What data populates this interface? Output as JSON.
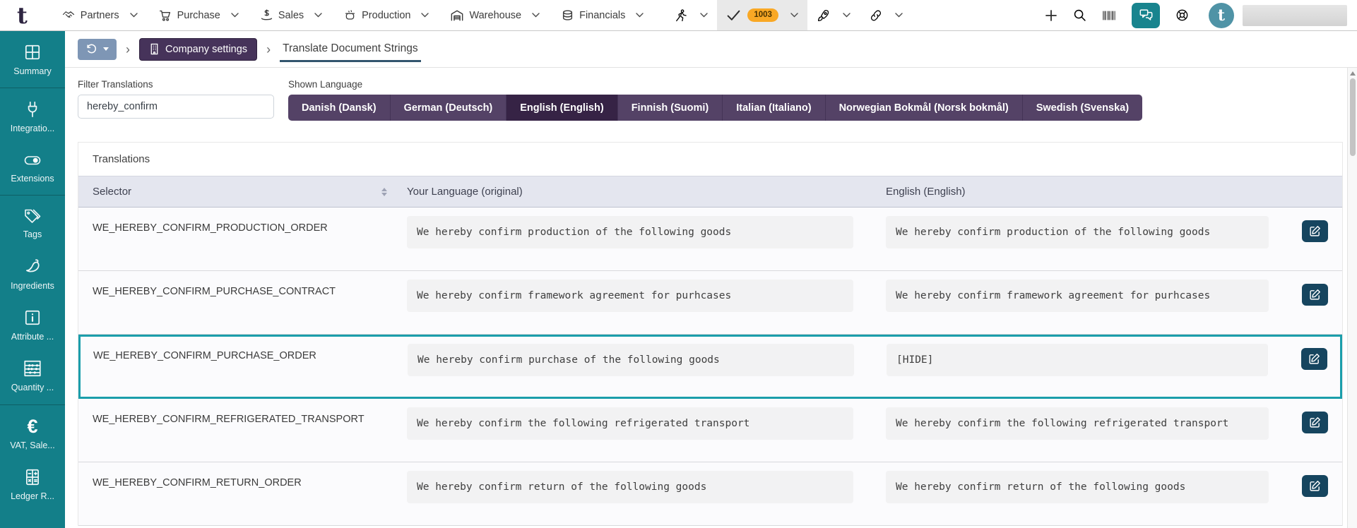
{
  "topbar": {
    "logo_letter": "t",
    "menus": [
      {
        "label": "Partners",
        "icon": "handshake-icon"
      },
      {
        "label": "Purchase",
        "icon": "cart-icon"
      },
      {
        "label": "Sales",
        "icon": "hand-dollar-icon"
      },
      {
        "label": "Production",
        "icon": "pot-icon"
      },
      {
        "label": "Warehouse",
        "icon": "warehouse-icon"
      },
      {
        "label": "Financials",
        "icon": "coins-icon"
      }
    ],
    "icon_menus": [
      {
        "icon": "runner-icon",
        "active": false,
        "badge": null
      },
      {
        "icon": "checkmark-icon",
        "active": true,
        "badge": "1003"
      },
      {
        "icon": "rocket-icon",
        "active": false,
        "badge": null
      },
      {
        "icon": "link-icon",
        "active": false,
        "badge": null
      }
    ],
    "action_icons": [
      "plus-icon",
      "search-icon",
      "barcode-icon",
      "chat-icon",
      "lifebuoy-icon"
    ],
    "avatar_letter": "t"
  },
  "sidebar": {
    "groups": [
      {
        "items": [
          {
            "label": "Summary",
            "icon": "grid-icon"
          }
        ]
      },
      {
        "items": [
          {
            "label": "Integratio...",
            "icon": "plug-icon"
          },
          {
            "label": "Extensions",
            "icon": "toggle-icon"
          }
        ]
      },
      {
        "items": [
          {
            "label": "Tags",
            "icon": "tags-icon"
          },
          {
            "label": "Ingredients",
            "icon": "pepper-icon"
          },
          {
            "label": "Attribute ...",
            "icon": "info-square-icon"
          },
          {
            "label": "Quantity ...",
            "icon": "abacus-icon"
          }
        ]
      },
      {
        "items": [
          {
            "label": "VAT, Sale...",
            "icon": "euro-icon"
          },
          {
            "label": "Ledger R...",
            "icon": "calculator-icon"
          }
        ]
      }
    ]
  },
  "breadcrumb": {
    "company_settings_label": "Company settings",
    "current_label": "Translate Document Strings",
    "separator": "›"
  },
  "filters": {
    "filter_label": "Filter Translations",
    "filter_value": "hereby_confirm",
    "language_label": "Shown Language",
    "languages": [
      "Danish (Dansk)",
      "German (Deutsch)",
      "English (English)",
      "Finnish (Suomi)",
      "Italian (Italiano)",
      "Norwegian Bokmål (Norsk bokmål)",
      "Swedish (Svenska)"
    ],
    "selected_language": "English (English)"
  },
  "table": {
    "title": "Translations",
    "columns": {
      "selector": "Selector",
      "original": "Your Language (original)",
      "translation": "English (English)"
    },
    "rows": [
      {
        "selector": "WE_HEREBY_CONFIRM_PRODUCTION_ORDER",
        "original": "We hereby confirm production of the following goods",
        "translation": "We hereby confirm production of the following goods",
        "highlighted": false
      },
      {
        "selector": "WE_HEREBY_CONFIRM_PURCHASE_CONTRACT",
        "original": "We hereby confirm framework agreement for purhcases",
        "translation": "We hereby confirm framework agreement for purhcases",
        "highlighted": false
      },
      {
        "selector": "WE_HEREBY_CONFIRM_PURCHASE_ORDER",
        "original": "We hereby confirm purchase of the following goods",
        "translation": "[HIDE]",
        "highlighted": true
      },
      {
        "selector": "WE_HEREBY_CONFIRM_REFRIGERATED_TRANSPORT",
        "original": "We hereby confirm the following refrigerated transport",
        "translation": "We hereby confirm the following refrigerated transport",
        "highlighted": false
      },
      {
        "selector": "WE_HEREBY_CONFIRM_RETURN_ORDER",
        "original": "We hereby confirm return of the following goods",
        "translation": "We hereby confirm return of the following goods",
        "highlighted": false
      }
    ]
  },
  "colors": {
    "sidebar_teal": "#137f89",
    "chat_button_teal": "#18848e",
    "row_highlight_teal": "#1b9eab",
    "language_button_purple": "#544266",
    "language_selected_purple": "#362345",
    "company_button_purple": "#46335a",
    "history_button_blue": "#7e96b5",
    "badge_orange": "#f9a825",
    "edit_button_navy": "#16455f",
    "table_header_bg": "#e4e6ef"
  }
}
